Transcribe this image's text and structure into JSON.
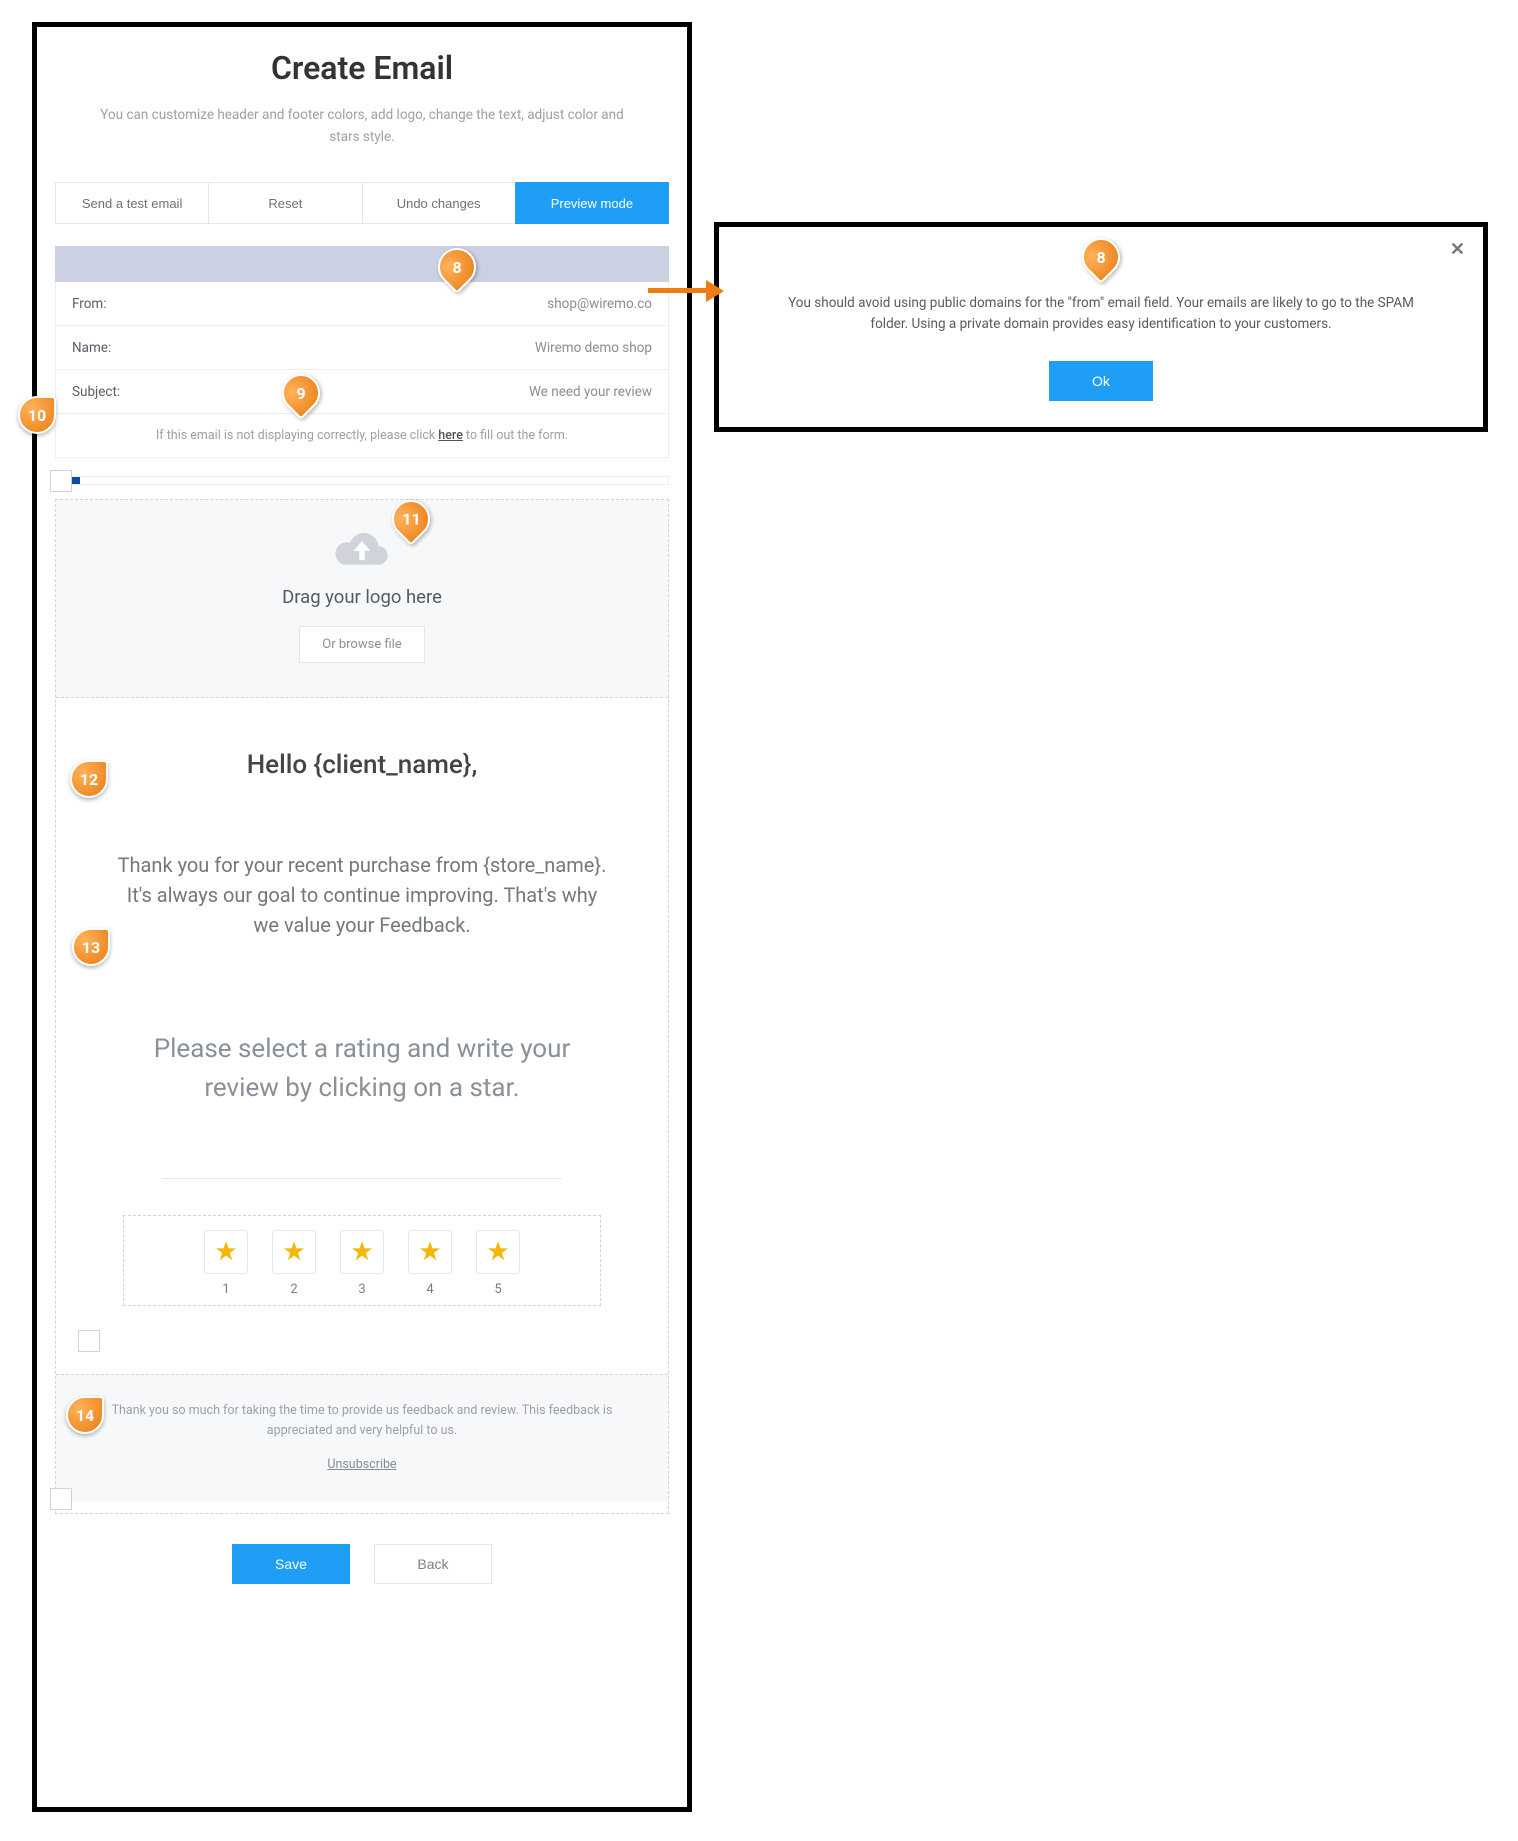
{
  "title": "Create Email",
  "subtitle": "You can customize header and footer colors, add logo, change the text, adjust color and stars style.",
  "toolbar": {
    "test": "Send a test email",
    "reset": "Reset",
    "undo": "Undo changes",
    "preview": "Preview mode"
  },
  "fields": {
    "from_label": "From:",
    "from_value": "shop@wiremo.co",
    "name_label": "Name:",
    "name_value": "Wiremo demo shop",
    "subject_label": "Subject:",
    "subject_value": "We need your review"
  },
  "hint": {
    "pre": "If this email is not displaying correctly, please click ",
    "link": "here",
    "post": " to fill out the form."
  },
  "logo": {
    "drag": "Drag your logo here",
    "browse": "Or browse file"
  },
  "body": {
    "hello": "Hello {client_name},",
    "para1": "Thank you for your recent purchase from {store_name}. It's always our goal to continue improving. That's why we value your Feedback.",
    "para2": "Please select a rating and write your review by clicking on a star."
  },
  "stars": {
    "labels": [
      "1",
      "2",
      "3",
      "4",
      "5"
    ]
  },
  "footer": {
    "text": "Thank you so much for taking the time to provide us feedback and review. This feedback is appreciated and very helpful to us.",
    "unsub": "Unsubscribe"
  },
  "actions": {
    "save": "Save",
    "back": "Back"
  },
  "dialog": {
    "msg": "You should avoid using public domains for the \"from\" email field. Your emails are likely to go to the SPAM folder. Using a private domain provides easy identification to your customers.",
    "ok": "Ok"
  },
  "callouts": {
    "c8": "8",
    "c8b": "8",
    "c9": "9",
    "c10": "10",
    "c11": "11",
    "c12": "12",
    "c13": "13",
    "c14": "14"
  }
}
